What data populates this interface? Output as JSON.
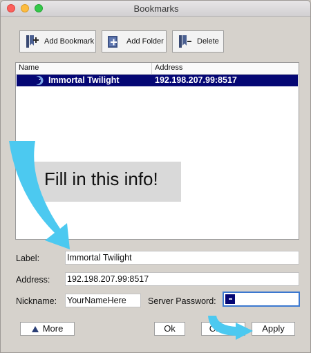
{
  "window": {
    "title": "Bookmarks"
  },
  "toolbar": {
    "add_bookmark_label": "Add Bookmark",
    "add_folder_label": "Add Folder",
    "delete_label": "Delete"
  },
  "list": {
    "columns": [
      "Name",
      "Address"
    ],
    "rows": [
      {
        "name": "Immortal Twilight",
        "address": "192.198.207.99:8517",
        "selected": true
      }
    ]
  },
  "callout": {
    "text": "Fill in this info!"
  },
  "form": {
    "label_caption": "Label:",
    "label_value": "Immortal Twilight",
    "address_caption": "Address:",
    "address_value": "192.198.207.99:8517",
    "nickname_caption": "Nickname:",
    "nickname_value": "YourNameHere",
    "password_caption": "Server Password:",
    "password_value": "••"
  },
  "buttons": {
    "more": "More",
    "ok": "Ok",
    "cancel": "Cancel",
    "apply": "Apply"
  },
  "colors": {
    "selection": "#050774",
    "arrow": "#4cc9f0",
    "window": "#d6d2cc"
  },
  "icons": [
    "add-bookmark-icon",
    "add-folder-icon",
    "delete-icon",
    "moon-icon",
    "more-triangle-icon",
    "annotation-arrow-icon"
  ]
}
